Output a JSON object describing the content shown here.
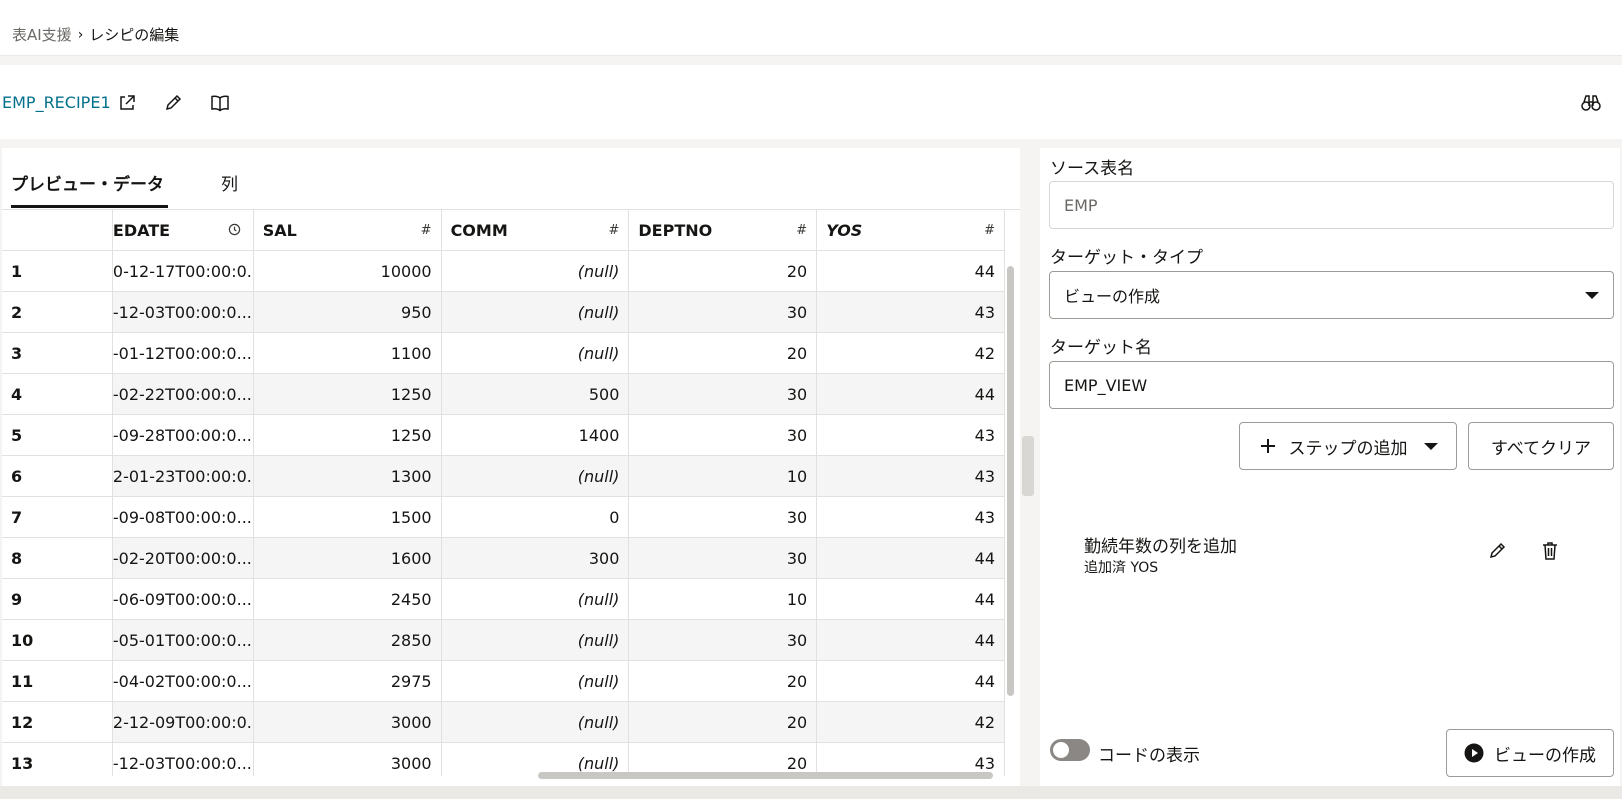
{
  "breadcrumb": {
    "parent": "表AI支援",
    "separator": "›",
    "current": "レシピの編集"
  },
  "recipe": {
    "name": "EMP_RECIPE1",
    "icons": [
      "share-icon",
      "pencil-icon",
      "book-icon",
      "binoculars-icon"
    ]
  },
  "tabs": [
    {
      "label": "プレビュー・データ",
      "active": true
    },
    {
      "label": "列",
      "active": false
    }
  ],
  "grid": {
    "columns": [
      {
        "label": "EDATE",
        "type_icon": "clock-icon"
      },
      {
        "label": "SAL",
        "type_icon": "#"
      },
      {
        "label": "COMM",
        "type_icon": "#"
      },
      {
        "label": "DEPTNO",
        "type_icon": "#"
      },
      {
        "label": "YOS",
        "type_icon": "#"
      }
    ],
    "rows": [
      {
        "n": "1",
        "hire": "0-12-17T00:00:0...",
        "sal": "10000",
        "comm": "(null)",
        "dept": "20",
        "yos": "44"
      },
      {
        "n": "2",
        "hire": "-12-03T00:00:0...",
        "sal": "950",
        "comm": "(null)",
        "dept": "30",
        "yos": "43"
      },
      {
        "n": "3",
        "hire": "-01-12T00:00:0...",
        "sal": "1100",
        "comm": "(null)",
        "dept": "20",
        "yos": "42"
      },
      {
        "n": "4",
        "hire": "-02-22T00:00:0...",
        "sal": "1250",
        "comm": "500",
        "dept": "30",
        "yos": "44"
      },
      {
        "n": "5",
        "hire": "-09-28T00:00:0...",
        "sal": "1250",
        "comm": "1400",
        "dept": "30",
        "yos": "43"
      },
      {
        "n": "6",
        "hire": "2-01-23T00:00:0...",
        "sal": "1300",
        "comm": "(null)",
        "dept": "10",
        "yos": "43"
      },
      {
        "n": "7",
        "hire": "-09-08T00:00:0...",
        "sal": "1500",
        "comm": "0",
        "dept": "30",
        "yos": "43"
      },
      {
        "n": "8",
        "hire": "-02-20T00:00:0...",
        "sal": "1600",
        "comm": "300",
        "dept": "30",
        "yos": "44"
      },
      {
        "n": "9",
        "hire": "-06-09T00:00:0...",
        "sal": "2450",
        "comm": "(null)",
        "dept": "10",
        "yos": "44"
      },
      {
        "n": "10",
        "hire": "-05-01T00:00:0...",
        "sal": "2850",
        "comm": "(null)",
        "dept": "30",
        "yos": "44"
      },
      {
        "n": "11",
        "hire": "-04-02T00:00:0...",
        "sal": "2975",
        "comm": "(null)",
        "dept": "20",
        "yos": "44"
      },
      {
        "n": "12",
        "hire": "2-12-09T00:00:0...",
        "sal": "3000",
        "comm": "(null)",
        "dept": "20",
        "yos": "42"
      },
      {
        "n": "13",
        "hire": "-12-03T00:00:0...",
        "sal": "3000",
        "comm": "(null)",
        "dept": "20",
        "yos": "43"
      }
    ]
  },
  "form": {
    "source_label": "ソース表名",
    "source_value": "EMP",
    "target_type_label": "ターゲット・タイプ",
    "target_type_value": "ビューの作成",
    "target_name_label": "ターゲット名",
    "target_name_value": "EMP_VIEW",
    "add_step_label": "ステップの追加",
    "clear_all_label": "すべてクリア"
  },
  "steps": [
    {
      "title": "勤続年数の列を追加",
      "subtitle": "追加済 YOS"
    }
  ],
  "footer": {
    "show_code_label": "コードの表示",
    "show_code_on": false,
    "create_view_label": "ビューの作成"
  },
  "colors": {
    "link": "#04718c",
    "text": "#161513",
    "border": "#9e9b97",
    "row_alt": "#f5f5f5"
  }
}
